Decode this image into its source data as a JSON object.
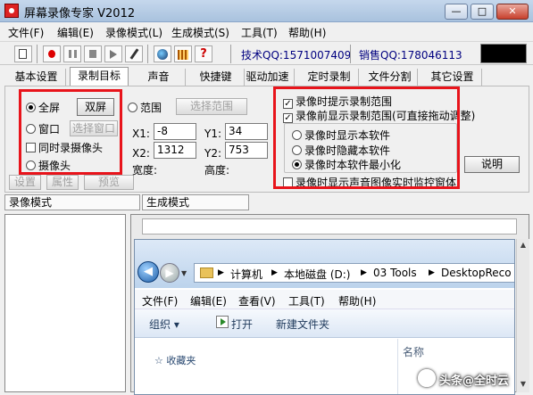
{
  "window": {
    "title": "屏幕录像专家 V2012",
    "min": "—",
    "max": "□",
    "close": "✕"
  },
  "menu": [
    "文件(F)",
    "编辑(E)",
    "录像模式(L)",
    "生成模式(S)",
    "工具(T)",
    "帮助(H)"
  ],
  "toolbar": {
    "tech_qq": "技术QQ:1571007409",
    "sales_qq": "销售QQ:178046113",
    "help_glyph": "?"
  },
  "tabs": [
    "基本设置",
    "录制目标",
    "声音",
    "快捷键",
    "驱动加速",
    "定时录制",
    "文件分割",
    "其它设置"
  ],
  "target": {
    "fullscreen": "全屏",
    "dual_screen": "双屏",
    "window": "窗口",
    "select_window": "选择窗口",
    "record_camera": "同时录摄像头",
    "camera": "摄像头",
    "settings": "设置",
    "properties": "属性",
    "preview": "预览",
    "region": "范围",
    "select_region": "选择范围",
    "x1_label": "X1:",
    "x1_value": "-8",
    "y1_label": "Y1:",
    "y1_value": "34",
    "x2_label": "X2:",
    "x2_value": "1312",
    "y2_label": "Y2:",
    "y2_value": "753",
    "width_label": "宽度:",
    "height_label": "高度:"
  },
  "options": {
    "show_range_while_recording": "录像时提示录制范围",
    "show_range_before_recording": "录像前显示录制范围(可直接拖动调整)",
    "show_software": "录像时显示本软件",
    "hide_software": "录像时隐藏本软件",
    "minimize_software": "录像时本软件最小化",
    "explain": "说明",
    "show_monitor_window": "录像时显示声音图像实时监控窗体"
  },
  "bottom_tabs": [
    "录像模式",
    "生成模式"
  ],
  "explorer": {
    "back": "◀",
    "forward": "▶",
    "dropdown": "▼",
    "path": [
      "计算机",
      "▶",
      "本地磁盘 (D:)",
      "▶",
      "03 Tools",
      "▶",
      "DesktopReco"
    ],
    "sep": "▶",
    "menu": [
      "文件(F)",
      "编辑(E)",
      "查看(V)",
      "工具(T)",
      "帮助(H)"
    ],
    "organize": "组织 ▾",
    "open": "打开",
    "new_folder": "新建文件夹",
    "column_name": "名称",
    "favorites": "☆ 收藏夹"
  },
  "scrollbar": {
    "up": "▲",
    "down": "▼"
  },
  "watermark": {
    "text": "头条@全时云"
  },
  "colors": {
    "highlight": "#e8141b",
    "titlebar": "#a9c2de",
    "qq_text": "#000080"
  }
}
